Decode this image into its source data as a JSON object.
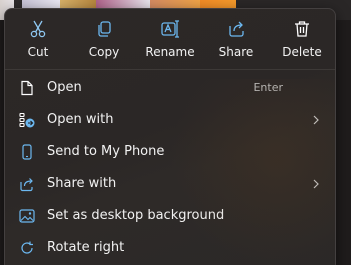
{
  "toolbar": {
    "cut": {
      "label": "Cut",
      "icon": "scissors-icon"
    },
    "copy": {
      "label": "Copy",
      "icon": "copy-icon"
    },
    "rename": {
      "label": "Rename",
      "icon": "rename-icon"
    },
    "share": {
      "label": "Share",
      "icon": "share-icon"
    },
    "delete": {
      "label": "Delete",
      "icon": "trash-icon"
    }
  },
  "menu": {
    "items": [
      {
        "label": "Open",
        "shortcut": "Enter",
        "icon": "open-file-icon"
      },
      {
        "label": "Open with",
        "icon": "open-with-icon",
        "has_submenu": true
      },
      {
        "label": "Send to My Phone",
        "icon": "phone-icon"
      },
      {
        "label": "Share with",
        "icon": "share-with-icon",
        "has_submenu": true
      },
      {
        "label": "Set as desktop background",
        "icon": "desktop-background-icon"
      },
      {
        "label": "Rotate right",
        "icon": "rotate-right-icon"
      }
    ]
  },
  "colors": {
    "menu_bg": "#2b2726",
    "text": "#f2f2f2",
    "icon_blue": "#6cb8f0",
    "icon_white": "#ffffff"
  }
}
